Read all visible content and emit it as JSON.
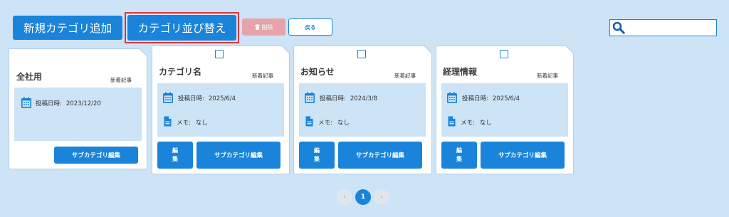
{
  "toolbar": {
    "add_label": "新規カテゴリ追加",
    "sort_label": "カテゴリ並び替え",
    "delete_label": "削除",
    "back_label": "戻る"
  },
  "cards": [
    {
      "title": "全社用",
      "badge": "新着記事",
      "posted_label": "投稿日時:",
      "posted": "2023/12/20",
      "sub_edit_label": "サブカテゴリ編集"
    },
    {
      "title": "カテゴリ名",
      "badge": "新着記事",
      "posted_label": "投稿日時:",
      "posted": "2025/6/4",
      "memo_label": "メモ:",
      "memo": "なし",
      "edit_label": "編集",
      "sub_edit_label": "サブカテゴリ編集",
      "checked": false
    },
    {
      "title": "お知らせ",
      "badge": "新着記事",
      "posted_label": "投稿日時:",
      "posted": "2024/3/8",
      "memo_label": "メモ:",
      "memo": "なし",
      "edit_label": "編集",
      "sub_edit_label": "サブカテゴリ編集",
      "checked": false
    },
    {
      "title": "経理情報",
      "badge": "新着記事",
      "posted_label": "投稿日時:",
      "posted": "2025/6/4",
      "memo_label": "メモ:",
      "memo": "なし",
      "edit_label": "編集",
      "sub_edit_label": "サブカテゴリ編集",
      "checked": false
    }
  ],
  "pagination": {
    "prev": "‹",
    "current": "1",
    "next": "›"
  },
  "icons": {
    "search": "search-icon",
    "delete": "trash-icon",
    "posted": "calendar-icon",
    "memo": "document-icon"
  },
  "colors": {
    "background": "#cde3f6",
    "primary": "#1a84da",
    "delete_disabled": "#e6a3aa",
    "highlight_outline": "#d9363e",
    "card_border": "#b6d0ea",
    "search_icon": "#1b5ea9"
  }
}
